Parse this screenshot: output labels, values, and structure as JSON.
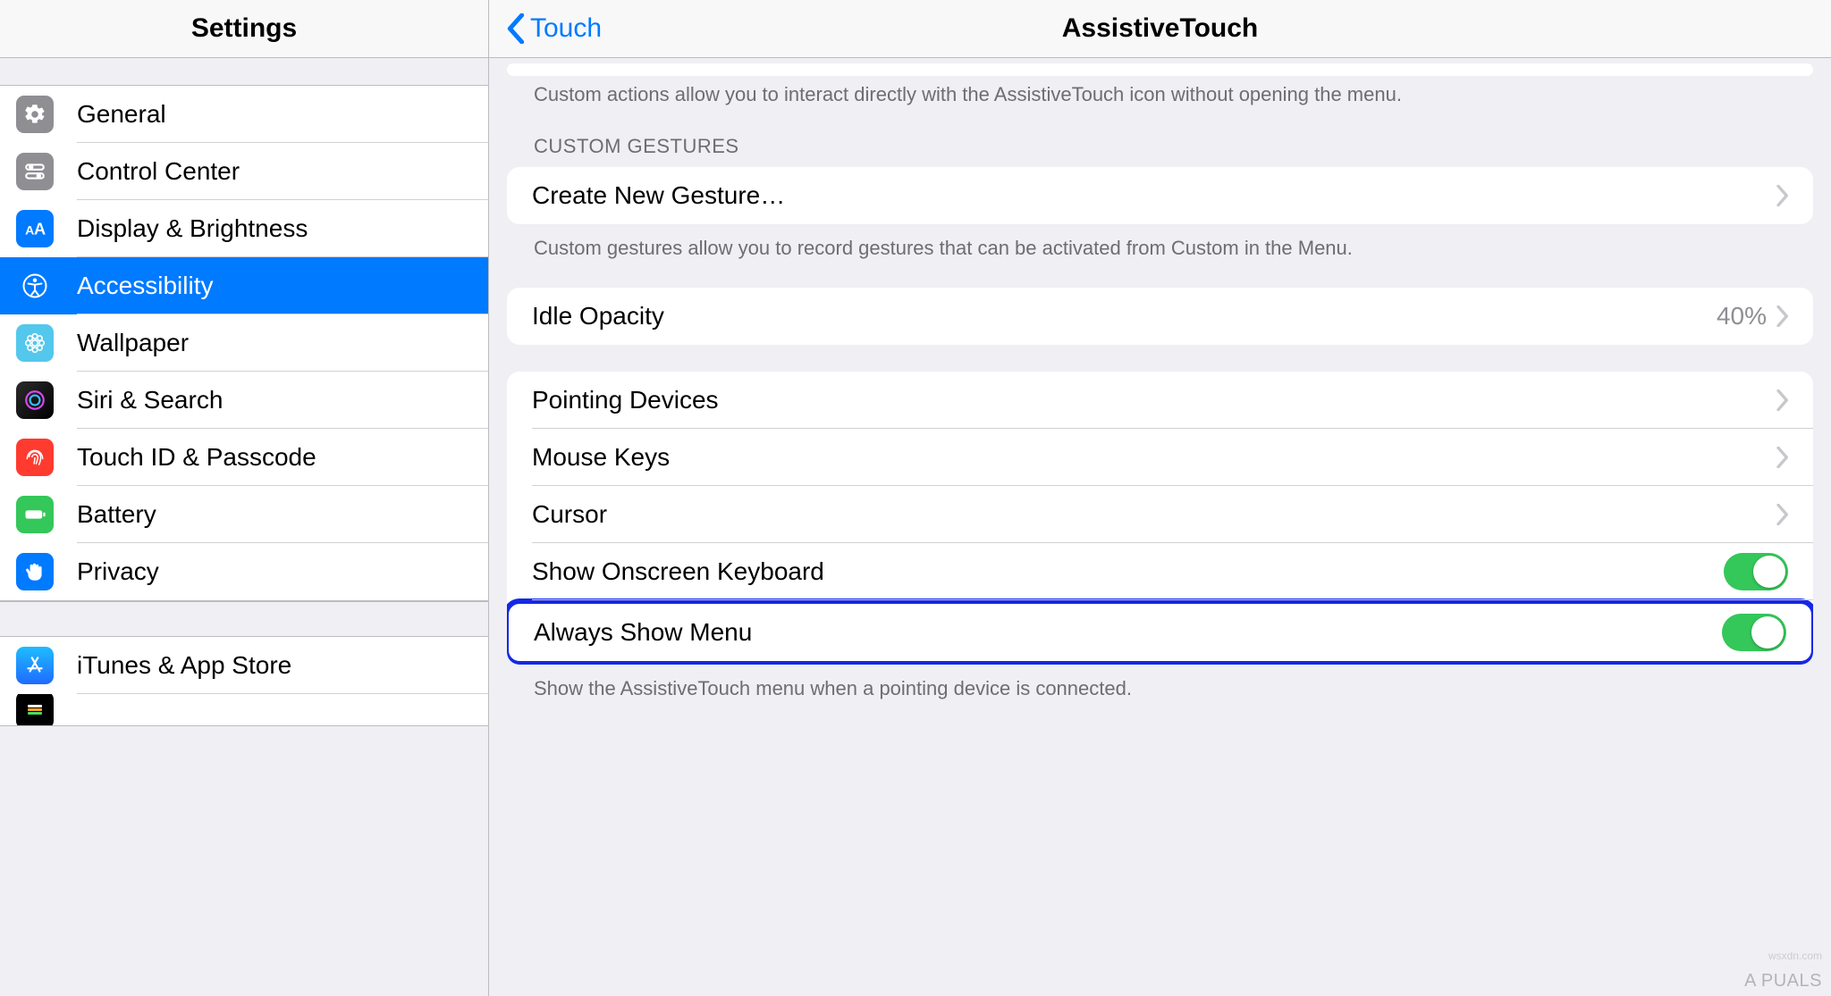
{
  "sidebar": {
    "title": "Settings",
    "items": [
      {
        "label": "General",
        "icon": "gear",
        "bg": "#8e8e93"
      },
      {
        "label": "Control Center",
        "icon": "switches",
        "bg": "#8e8e93"
      },
      {
        "label": "Display & Brightness",
        "icon": "textsize",
        "bg": "#007aff"
      },
      {
        "label": "Accessibility",
        "icon": "accessibility",
        "bg": "#007aff",
        "selected": true
      },
      {
        "label": "Wallpaper",
        "icon": "flower",
        "bg": "#54c7ec"
      },
      {
        "label": "Siri & Search",
        "icon": "siri",
        "bg": "#000000"
      },
      {
        "label": "Touch ID & Passcode",
        "icon": "fingerprint",
        "bg": "#ff3b30"
      },
      {
        "label": "Battery",
        "icon": "battery",
        "bg": "#34c759"
      },
      {
        "label": "Privacy",
        "icon": "hand",
        "bg": "#007aff"
      }
    ],
    "items2": [
      {
        "label": "iTunes & App Store",
        "icon": "appstore",
        "bg": "#1f8bff"
      }
    ]
  },
  "detail": {
    "back_label": "Touch",
    "title": "AssistiveTouch",
    "top_footer": "Custom actions allow you to interact directly with the AssistiveTouch icon without opening the menu.",
    "gestures_header": "CUSTOM GESTURES",
    "create_gesture": "Create New Gesture…",
    "gestures_footer": "Custom gestures allow you to record gestures that can be activated from Custom in the Menu.",
    "idle_opacity_label": "Idle Opacity",
    "idle_opacity_value": "40%",
    "pointing_devices": "Pointing Devices",
    "mouse_keys": "Mouse Keys",
    "cursor": "Cursor",
    "show_onscreen": "Show Onscreen Keyboard",
    "always_show": "Always Show Menu",
    "always_show_footer": "Show the AssistiveTouch menu when a pointing device is connected."
  },
  "watermark": "A   PUALS",
  "watermark_small": "wsxdn.com"
}
